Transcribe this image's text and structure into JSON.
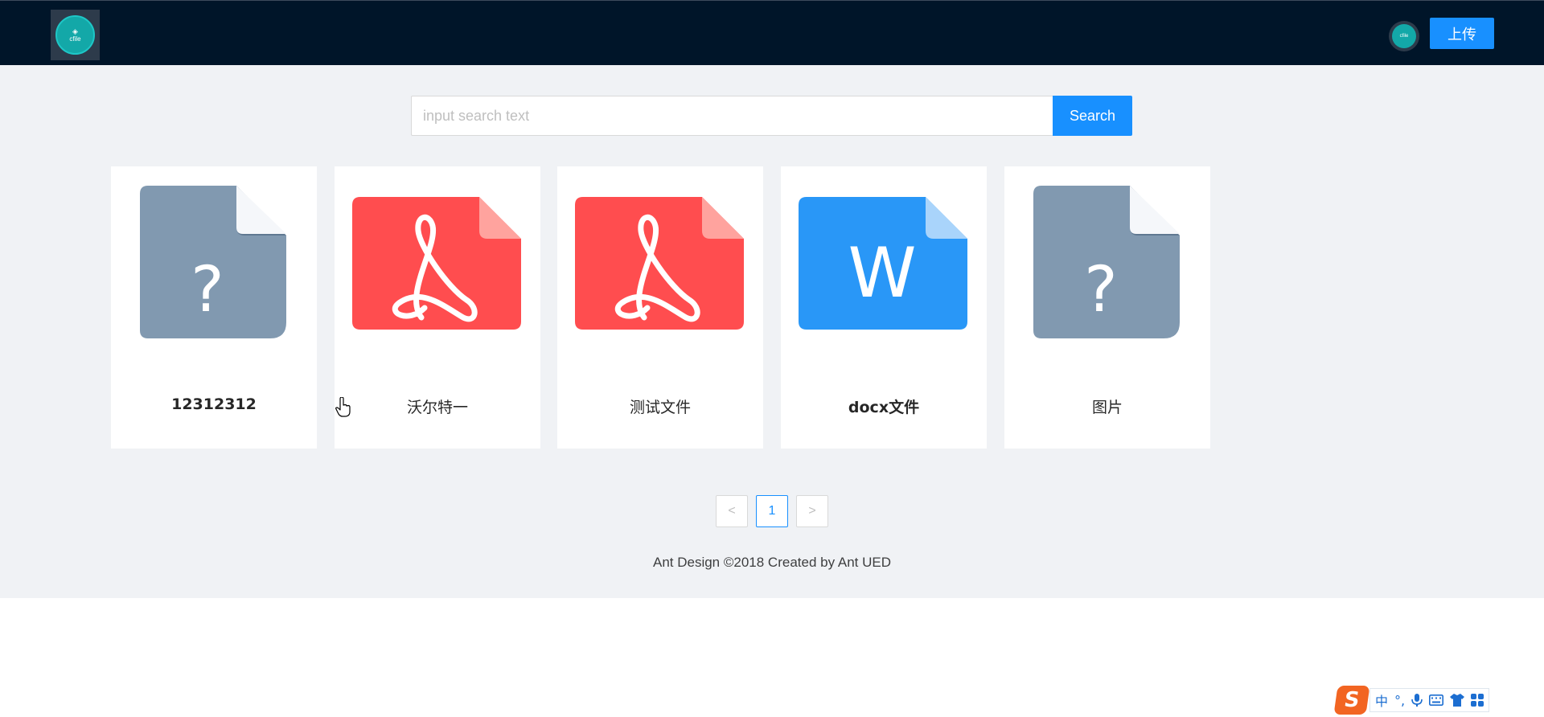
{
  "header": {
    "logo_text": "cfile",
    "avatar_text": "cfile",
    "upload_label": "上传"
  },
  "search": {
    "placeholder": "input search text",
    "value": "",
    "button_label": "Search"
  },
  "files": [
    {
      "name": "12312312",
      "icon": "unknown-file-icon"
    },
    {
      "name": "沃尔特一",
      "icon": "pdf-file-icon"
    },
    {
      "name": "测试文件",
      "icon": "pdf-file-icon"
    },
    {
      "name": "docx文件",
      "icon": "word-file-icon"
    },
    {
      "name": "图片",
      "icon": "unknown-file-icon"
    }
  ],
  "icon_glyphs": {
    "unknown": "?",
    "word": "W"
  },
  "pagination": {
    "prev": "<",
    "current": "1",
    "next": ">"
  },
  "footer": {
    "text": "Ant Design ©2018 Created by Ant UED"
  },
  "ime": {
    "logo": "S",
    "lang": "中",
    "punct": "°,"
  },
  "colors": {
    "header_bg": "#001529",
    "content_bg": "#f0f2f5",
    "primary": "#1890ff",
    "pdf_red": "#ff4d4f",
    "unknown_gray": "#8199b0",
    "word_blue": "#2997f7"
  }
}
